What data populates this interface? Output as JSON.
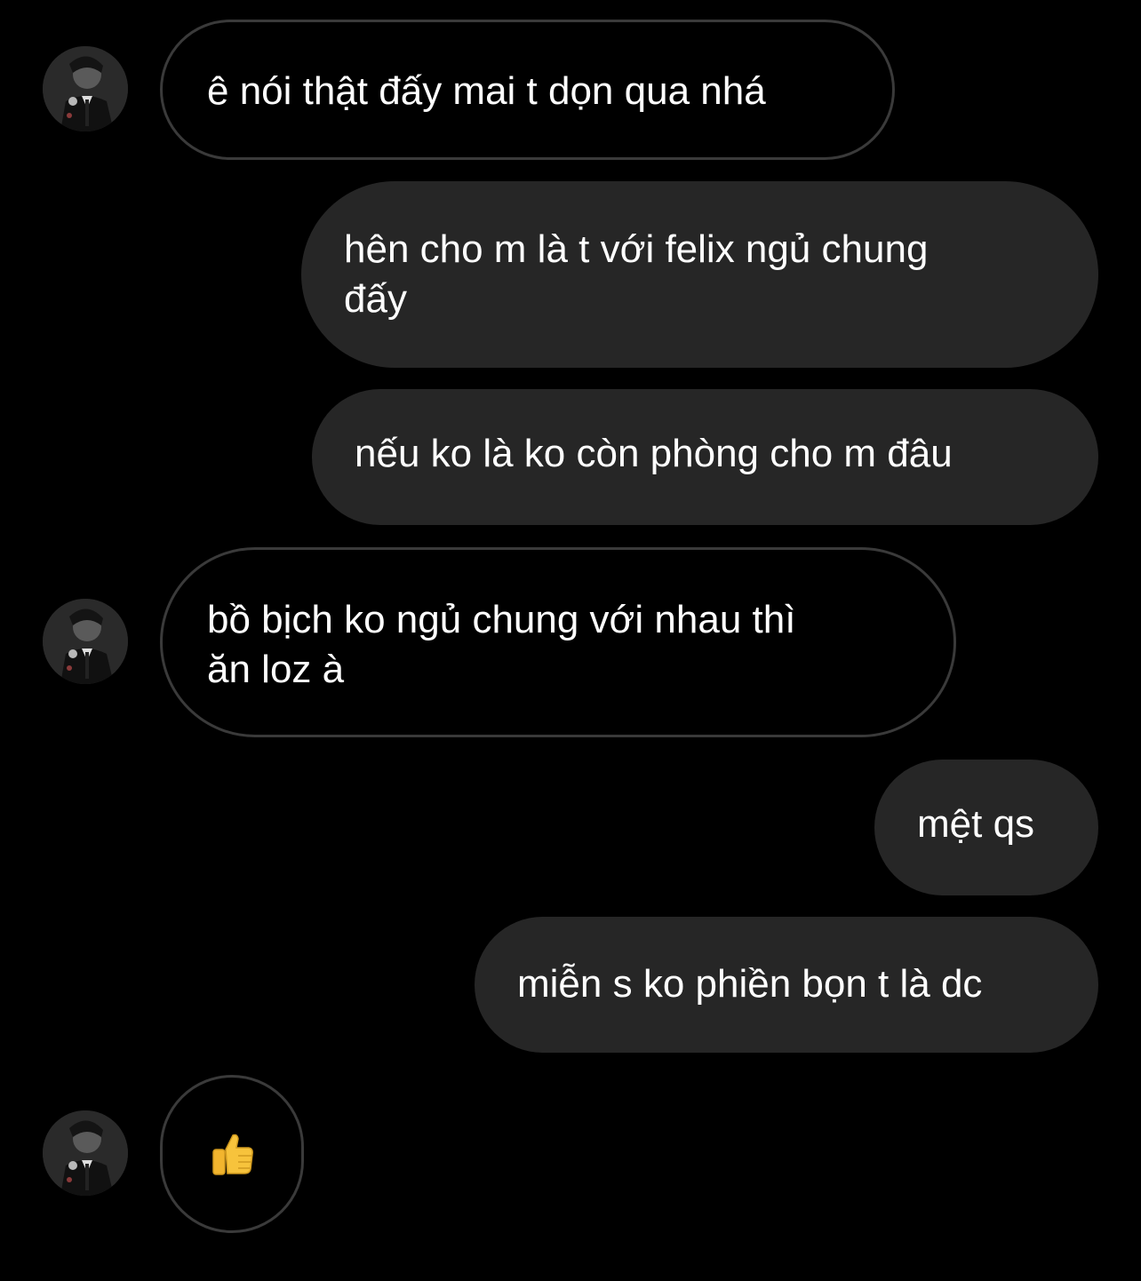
{
  "conversation": {
    "messages": [
      {
        "sender": "contact",
        "text": "ê nói thật đấy mai t dọn qua nhá",
        "avatar": "contact-avatar"
      },
      {
        "sender": "self",
        "lines": [
          "hên cho m là t với felix ngủ chung",
          "đấy"
        ]
      },
      {
        "sender": "self",
        "text": "nếu ko là ko còn phòng cho m đâu"
      },
      {
        "sender": "contact",
        "lines": [
          "bồ bịch ko ngủ chung với nhau thì",
          "ăn loz à"
        ],
        "avatar": "contact-avatar"
      },
      {
        "sender": "self",
        "text": "mệt qs"
      },
      {
        "sender": "self",
        "text": "miễn s ko phiền bọn t là dc"
      },
      {
        "sender": "contact",
        "icon": "thumbs-up-icon",
        "avatar": "contact-avatar"
      }
    ]
  },
  "colors": {
    "background": "#000000",
    "outgoing_bubble": "#262626",
    "incoming_border": "#3a3a3a",
    "text": "#ffffff",
    "thumbs_up": "#f7c33c"
  }
}
